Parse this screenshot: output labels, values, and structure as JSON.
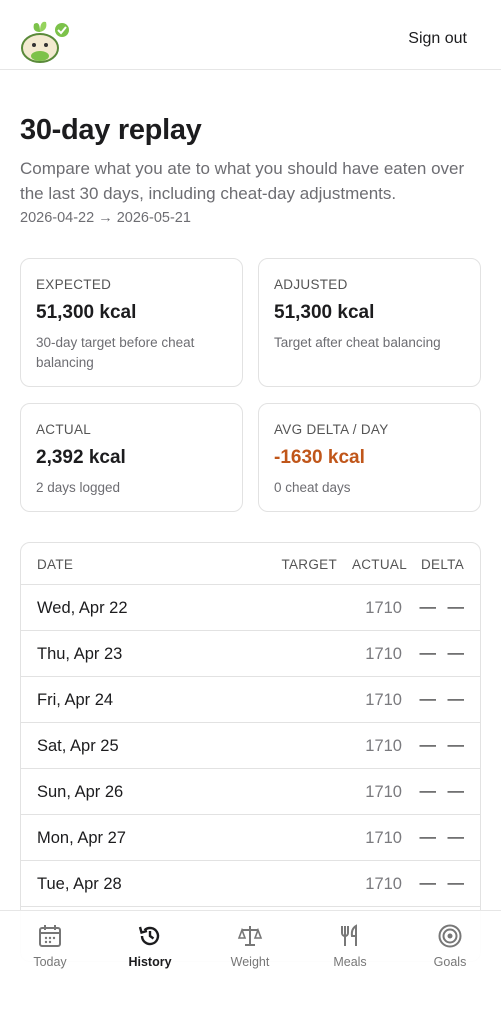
{
  "header": {
    "signout_label": "Sign out"
  },
  "page": {
    "title": "30-day replay",
    "subtitle": "Compare what you ate to what you should have eaten over the last 30 days, including cheat-day adjustments.",
    "range": "2026-04-22 → 2026-05-21"
  },
  "cards": {
    "expected": {
      "label": "EXPECTED",
      "value": "51,300 kcal",
      "note": "30-day target before cheat balancing"
    },
    "adjusted": {
      "label": "ADJUSTED",
      "value": "51,300 kcal",
      "note": "Target after cheat balancing"
    },
    "actual": {
      "label": "ACTUAL",
      "value": "2,392 kcal",
      "note": "2 days logged"
    },
    "avg_delta": {
      "label": "AVG DELTA / DAY",
      "value": "-1630 kcal",
      "note": "0 cheat days",
      "color": "#c0561a"
    }
  },
  "table": {
    "headers": {
      "date": "DATE",
      "target": "TARGET",
      "actual": "ACTUAL",
      "delta": "DELTA"
    },
    "rows": [
      {
        "date": "Wed, Apr 22",
        "target": "1710",
        "actual": "—",
        "delta": "—"
      },
      {
        "date": "Thu, Apr 23",
        "target": "1710",
        "actual": "—",
        "delta": "—"
      },
      {
        "date": "Fri, Apr 24",
        "target": "1710",
        "actual": "—",
        "delta": "—"
      },
      {
        "date": "Sat, Apr 25",
        "target": "1710",
        "actual": "—",
        "delta": "—"
      },
      {
        "date": "Sun, Apr 26",
        "target": "1710",
        "actual": "—",
        "delta": "—"
      },
      {
        "date": "Mon, Apr 27",
        "target": "1710",
        "actual": "—",
        "delta": "—"
      },
      {
        "date": "Tue, Apr 28",
        "target": "1710",
        "actual": "—",
        "delta": "—"
      }
    ]
  },
  "nav": {
    "items": [
      {
        "label": "Today",
        "icon": "calendar-icon"
      },
      {
        "label": "History",
        "icon": "history-icon",
        "active": true
      },
      {
        "label": "Weight",
        "icon": "scale-icon"
      },
      {
        "label": "Meals",
        "icon": "utensils-icon"
      },
      {
        "label": "Goals",
        "icon": "target-icon"
      }
    ]
  },
  "colors": {
    "accent_negative": "#c0561a",
    "logo_green": "#7cc24a",
    "border": "#e2e2e2"
  }
}
